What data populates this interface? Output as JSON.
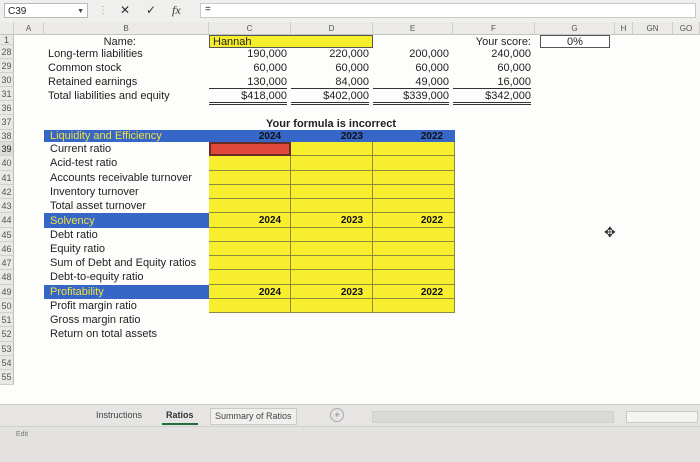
{
  "formula_bar": {
    "cell_ref": "C39",
    "cancel_glyph": "✕",
    "confirm_glyph": "✓",
    "fx_glyph": "fx",
    "eq_glyph": "=",
    "formula": ""
  },
  "columns": [
    "A",
    "B",
    "C",
    "D",
    "E",
    "F",
    "G",
    "H",
    "GN",
    "GO"
  ],
  "rows": [
    "1",
    "28",
    "29",
    "30",
    "31",
    "36",
    "37",
    "38",
    "39",
    "40",
    "41",
    "42",
    "43",
    "44",
    "45",
    "46",
    "47",
    "48",
    "49",
    "50",
    "51",
    "52",
    "53",
    "54",
    "55"
  ],
  "sheet": {
    "name_label": "Name:",
    "name_value": "Hannah",
    "score_label": "Your score:",
    "score_value": "0%",
    "balance": [
      {
        "label": "Long-term liabilities",
        "c": "190,000",
        "d": "220,000",
        "e": "200,000",
        "f": "240,000"
      },
      {
        "label": "Common stock",
        "c": "60,000",
        "d": "60,000",
        "e": "60,000",
        "f": "60,000"
      },
      {
        "label": "Retained earnings",
        "c": "130,000",
        "d": "84,000",
        "e": "49,000",
        "f": "16,000"
      },
      {
        "label": "Total liabilities and equity",
        "c": "$418,000",
        "d": "$402,000",
        "e": "$339,000",
        "f": "$342,000"
      }
    ],
    "feedback": "Your formula is incorrect",
    "sections": [
      {
        "title": "Liquidity and Efficiency",
        "years": [
          "2024",
          "2023",
          "2022"
        ],
        "items": [
          "Current ratio",
          "Acid-test ratio",
          "Accounts receivable turnover",
          "Inventory turnover",
          "Total asset turnover"
        ]
      },
      {
        "title": "Solvency",
        "years": [
          "2024",
          "2023",
          "2022"
        ],
        "items": [
          "Debt ratio",
          "Equity ratio",
          "Sum of Debt and Equity ratios",
          "Debt-to-equity ratio"
        ]
      },
      {
        "title": "Profitability",
        "years": [
          "2024",
          "2023",
          "2022"
        ],
        "items": [
          "Profit margin ratio",
          "Gross margin ratio",
          "Return on total assets"
        ]
      }
    ]
  },
  "tabs": [
    "Instructions",
    "Ratios",
    "Summary of Ratios"
  ],
  "add_sheet_glyph": "+",
  "status": "Edit",
  "colors": {
    "input_yellow": "#f7ef2e",
    "section_blue": "#3e67cd",
    "active_cell_red": "#e0483c"
  }
}
